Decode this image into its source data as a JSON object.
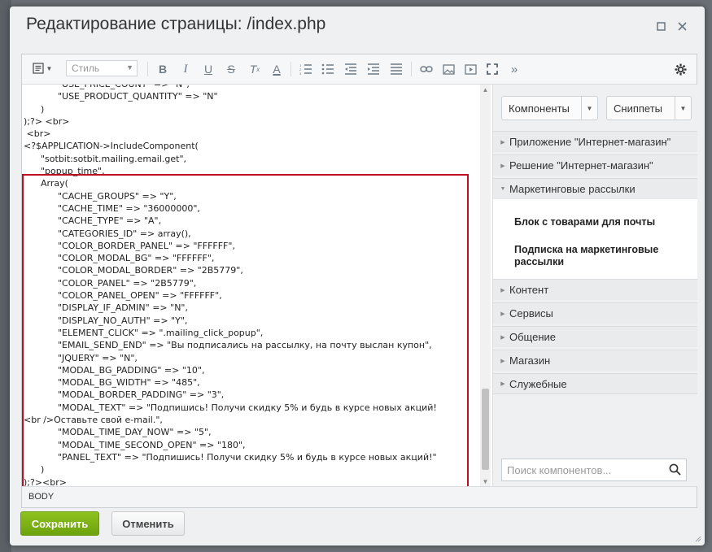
{
  "dialog": {
    "title": "Редактирование страницы: /index.php",
    "maximize_icon": "maximize-icon",
    "close_icon": "close-icon"
  },
  "toolbar": {
    "style_placeholder": "Стиль",
    "buttons": [
      "bold-icon",
      "italic-icon",
      "underline-icon",
      "strikethrough-icon",
      "clear-format-icon",
      "font-color-icon",
      "ordered-list-icon",
      "unordered-list-icon",
      "outdent-icon",
      "indent-icon",
      "align-icon",
      "link-icon",
      "image-icon",
      "video-icon",
      "fullscreen-icon",
      "more-icon",
      "settings-icon"
    ]
  },
  "code": {
    "lines": [
      "            \"USE_PRICE_COUNT\" => \"N\",",
      "            \"USE_PRODUCT_QUANTITY\" => \"N\"",
      "      )",
      ");?> <br>",
      " <br>",
      "<?$APPLICATION->IncludeComponent(",
      "      \"sotbit:sotbit.mailing.email.get\",",
      "      \"popup_time\",",
      "      Array(",
      "            \"CACHE_GROUPS\" => \"Y\",",
      "            \"CACHE_TIME\" => \"36000000\",",
      "            \"CACHE_TYPE\" => \"A\",",
      "            \"CATEGORIES_ID\" => array(),",
      "            \"COLOR_BORDER_PANEL\" => \"FFFFFF\",",
      "            \"COLOR_MODAL_BG\" => \"FFFFFF\",",
      "            \"COLOR_MODAL_BORDER\" => \"2B5779\",",
      "            \"COLOR_PANEL\" => \"2B5779\",",
      "            \"COLOR_PANEL_OPEN\" => \"FFFFFF\",",
      "            \"DISPLAY_IF_ADMIN\" => \"N\",",
      "            \"DISPLAY_NO_AUTH\" => \"Y\",",
      "            \"ELEMENT_CLICK\" => \".mailing_click_popup\",",
      "            \"EMAIL_SEND_END\" => \"Вы подписались на рассылку, на почту выслан купон\",",
      "            \"JQUERY\" => \"N\",",
      "            \"MODAL_BG_PADDING\" => \"10\",",
      "            \"MODAL_BG_WIDTH\" => \"485\",",
      "            \"MODAL_BORDER_PADDING\" => \"3\",",
      "            \"MODAL_TEXT\" => \"Подпишись! Получи скидку 5% и будь в курсе новых акций!",
      "<br />Оставьте свой e-mail.\",",
      "            \"MODAL_TIME_DAY_NOW\" => \"5\",",
      "            \"MODAL_TIME_SECOND_OPEN\" => \"180\",",
      "            \"PANEL_TEXT\" => \"Подпишись! Получи скидку 5% и будь в курсе новых акций!\"",
      "      )",
      ");?><br>"
    ]
  },
  "statusbar": {
    "path": "BODY"
  },
  "sidebar": {
    "components_label": "Компоненты",
    "snippets_label": "Сниппеты",
    "categories": [
      {
        "label": "Приложение \"Интернет-магазин\"",
        "open": false
      },
      {
        "label": "Решение \"Интернет-магазин\"",
        "open": false
      },
      {
        "label": "Маркетинговые рассылки",
        "open": true
      },
      {
        "label": "Контент",
        "open": false
      },
      {
        "label": "Сервисы",
        "open": false
      },
      {
        "label": "Общение",
        "open": false
      },
      {
        "label": "Магазин",
        "open": false
      },
      {
        "label": "Служебные",
        "open": false
      }
    ],
    "subitems": [
      "Блок с товарами для почты",
      "Подписка на маркетинговые рассылки"
    ],
    "search_placeholder": "Поиск компонентов..."
  },
  "footer": {
    "save_label": "Сохранить",
    "cancel_label": "Отменить"
  },
  "colors": {
    "highlight_border": "#c00d1f",
    "save_button": "#7cb518"
  }
}
